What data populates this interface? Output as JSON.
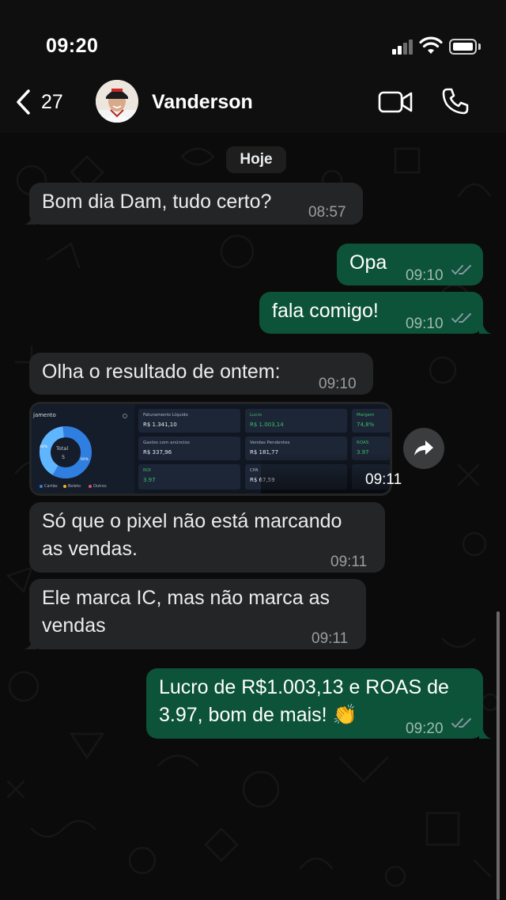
{
  "status_bar": {
    "time": "09:20"
  },
  "header": {
    "back_count": "27",
    "contact_name": "Vanderson"
  },
  "date_separator": "Hoje",
  "messages": [
    {
      "direction": "in",
      "text": "Bom dia Dam, tudo certo?",
      "time": "08:57"
    },
    {
      "direction": "out",
      "text": "Opa",
      "time": "09:10",
      "read": true
    },
    {
      "direction": "out",
      "text": "fala comigo!",
      "time": "09:10",
      "read": true
    },
    {
      "direction": "in",
      "text": "Olha o resultado de ontem:",
      "time": "09:10"
    },
    {
      "direction": "in",
      "type": "image",
      "time": "09:11"
    },
    {
      "direction": "in",
      "text": "Só que o pixel não está marcando\nas vendas.",
      "time": "09:11"
    },
    {
      "direction": "in",
      "text": "Ele marca IC, mas não marca as\nvendas",
      "time": "09:11"
    },
    {
      "direction": "out",
      "text": "Lucro de R$1.003,13 e ROAS de\n3.97, bom de mais! 👏",
      "time": "09:20",
      "read": true
    }
  ],
  "dashboard_image": {
    "title": "jamento",
    "donut_label": "Total",
    "donut_value": "5",
    "donut_left_pct": "40%",
    "donut_right_pct": "60%",
    "legend": [
      "Cartão",
      "Boleto",
      "Outros"
    ],
    "cards": [
      {
        "label": "Faturamento Líquido",
        "value": "R$ 1.341,10"
      },
      {
        "label": "Lucro",
        "value": "R$ 1.003,14"
      },
      {
        "label": "Margem",
        "value": "74,8%"
      },
      {
        "label": "Gastos com anúncios",
        "value": "R$ 337,96"
      },
      {
        "label": "Vendas Pendentes",
        "value": "R$ 181,77"
      },
      {
        "label": "ROAS",
        "value": "3.97"
      },
      {
        "label": "ROI",
        "value": "3.97"
      },
      {
        "label": "CPA",
        "value": "R$ 67,59"
      }
    ]
  },
  "colors": {
    "incoming_bubble": "#232526",
    "outgoing_bubble": "#0c5339",
    "read_ticks": "#8696a0",
    "background": "#0b0b0b"
  }
}
